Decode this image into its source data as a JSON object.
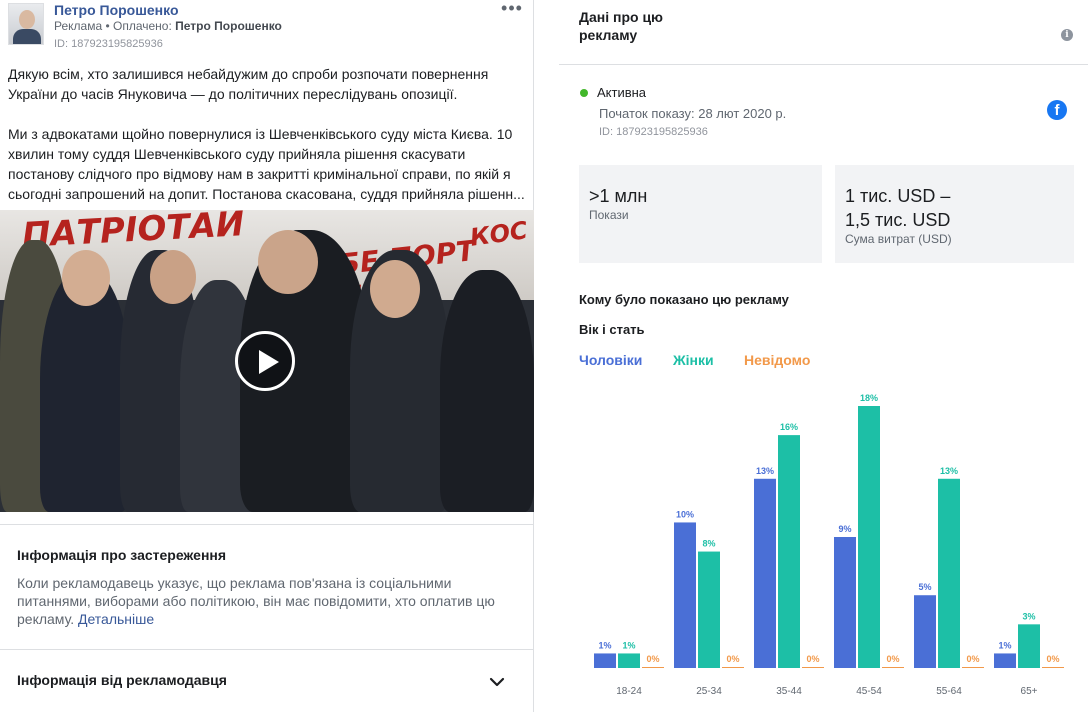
{
  "ad": {
    "page_name": "Петро Порошенко",
    "sponsored_prefix": "Реклама • Оплачено: ",
    "paid_by": "Петро Порошенко",
    "ad_id": "ID: 187923195825936",
    "more": "•••",
    "paragraph_1": "Дякую всім, хто залишився небайдужим до спроби розпочати повернення України до часів Януковича — до політичних переслідувань опозиції.",
    "paragraph_2": "Ми з адвокатами щойно повернулися із Шевченківського суду міста Києва. 10 хвилин тому суддя Шевченківського суду прийняла рішення скасувати постанову слідчого про відмову нам в закритті кримінальної справи, по якій я сьогодні запрошений на допит. Постанова скасована, суддя прийняла рішенн..."
  },
  "disclaimer": {
    "title": "Інформація про застереження",
    "text": "Коли рекламодавець указує, що реклама пов'язана із соціальними питаннями, виборами або політикою, він має повідомити, хто оплатив цю рекламу. ",
    "link": "Детальніше"
  },
  "advertiser_info": {
    "title": "Інформація від рекламодавця"
  },
  "panel": {
    "title": "Дані про цю рекламу",
    "status": "Активна",
    "start": "Початок показу: 28 лют 2020 р.",
    "id": "ID: 187923195825936",
    "impressions_value": ">1 млн",
    "impressions_label": "Покази",
    "spend_line1": "1 тис. USD –",
    "spend_line2": "1,5 тис. USD",
    "spend_label": "Сума витрат (USD)",
    "shown_title": "Кому було показано цю рекламу",
    "age_gender": "Вік і стать",
    "legend": {
      "men": "Чоловіки",
      "women": "Жінки",
      "unknown": "Невідомо"
    }
  },
  "colors": {
    "men": "#4a6fd6",
    "women": "#1dbfa6",
    "unknown": "#f2994a",
    "active": "#42b72a",
    "link": "#385898"
  },
  "chart_data": {
    "type": "bar",
    "categories": [
      "18-24",
      "25-34",
      "35-44",
      "45-54",
      "55-64",
      "65+"
    ],
    "series": [
      {
        "name": "Чоловіки",
        "values": [
          1,
          10,
          13,
          9,
          5,
          1
        ]
      },
      {
        "name": "Жінки",
        "values": [
          1,
          8,
          16,
          18,
          13,
          3
        ]
      },
      {
        "name": "Невідомо",
        "values": [
          0,
          0,
          0,
          0,
          0,
          0
        ]
      }
    ],
    "value_suffix": "%",
    "ylim": [
      0,
      18
    ]
  }
}
